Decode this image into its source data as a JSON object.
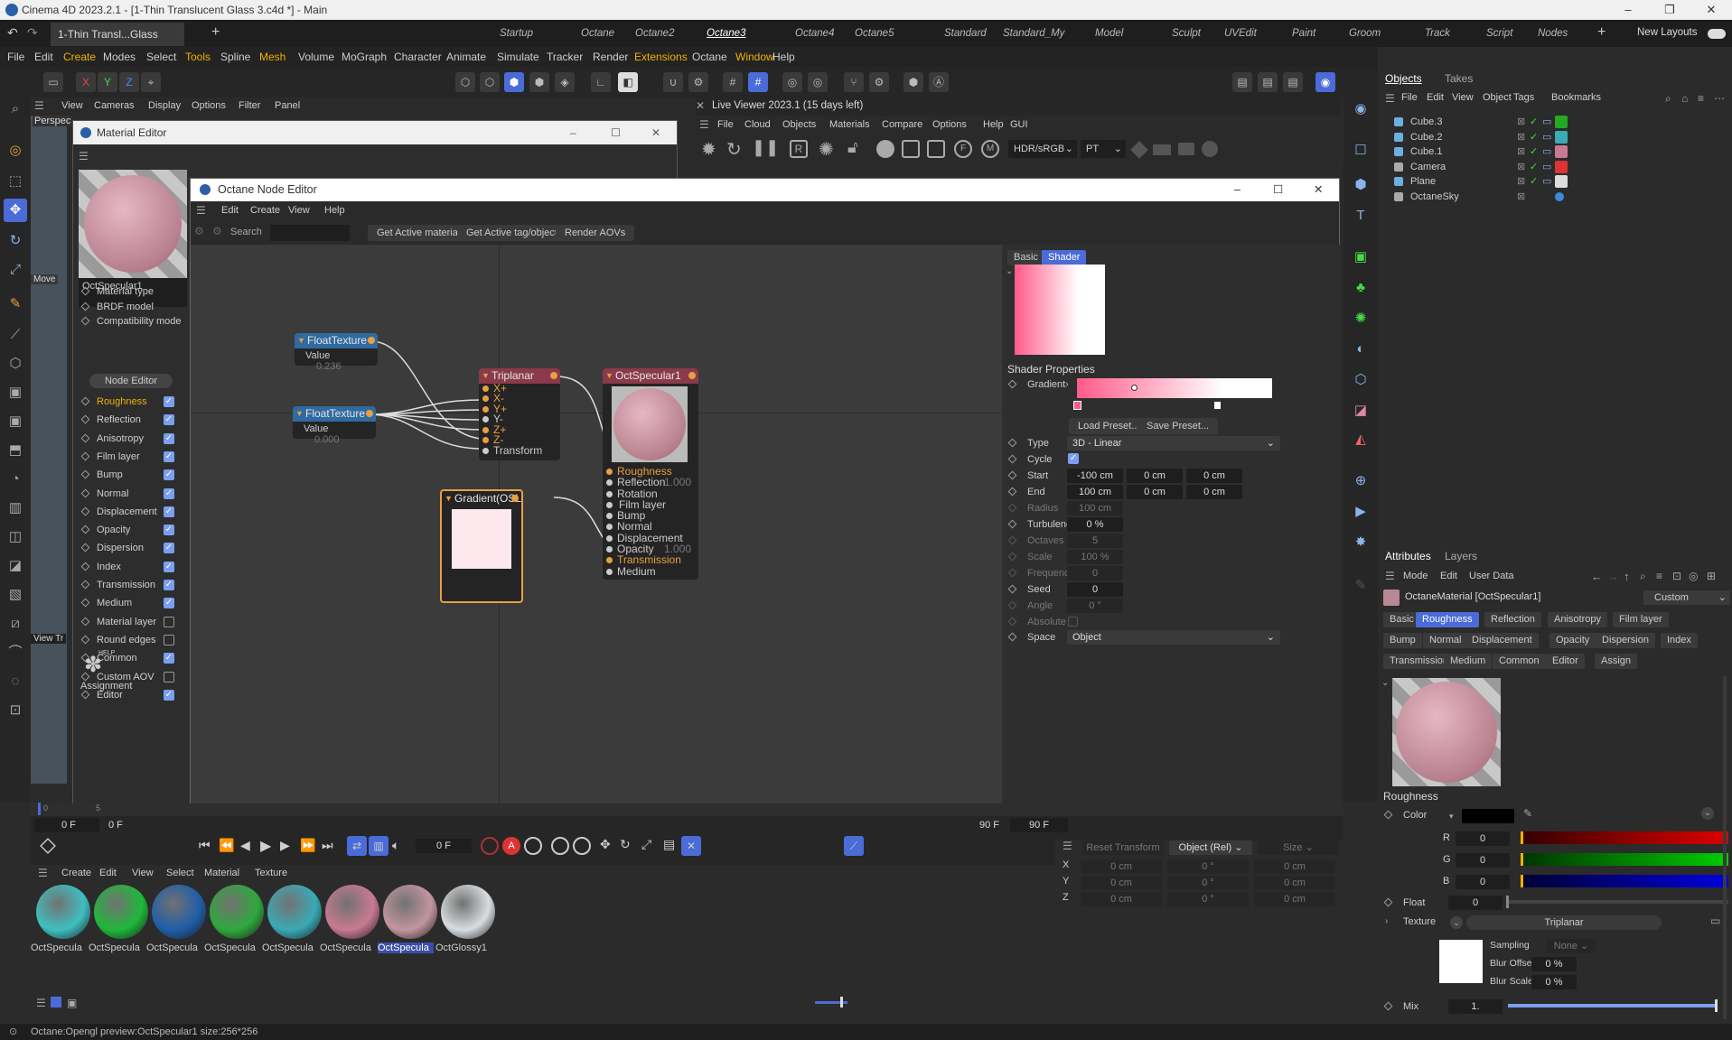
{
  "app": {
    "title": "Cinema 4D 2023.2.1 - [1-Thin Translucent Glass 3.c4d *] - Main",
    "doc_tab": "1-Thin Transl...Glass 3.c4d *"
  },
  "layouts": [
    "Startup",
    "Octane",
    "Octane2",
    "Octane3",
    "Octane4",
    "Octane5",
    "Standard",
    "Standard_My",
    "Model",
    "Sculpt",
    "UVEdit",
    "Paint",
    "Groom",
    "Track",
    "Script",
    "Nodes"
  ],
  "new_layouts": "New Layouts",
  "menu": [
    "File",
    "Edit",
    "Create",
    "Modes",
    "Select",
    "Tools",
    "Spline",
    "Mesh",
    "Volume",
    "MoGraph",
    "Character",
    "Animate",
    "Simulate",
    "Tracker",
    "Render",
    "Extensions",
    "Octane",
    "Window",
    "Help"
  ],
  "viewport": {
    "menu": [
      "View",
      "Cameras",
      "Display",
      "Options",
      "Filter",
      "Panel"
    ],
    "label": "Perspec",
    "move": "Move",
    "view_tr": "View Tr"
  },
  "live_viewer": {
    "title": "Live Viewer 2023.1 (15 days left)",
    "menu": [
      "File",
      "Cloud",
      "Objects",
      "Materials",
      "Compare",
      "Options",
      "Help",
      "GUI"
    ],
    "colorspace": "HDR/sRGB",
    "mode": "PT"
  },
  "material_editor": {
    "title": "Material Editor",
    "name": "OctSpecular1",
    "items": [
      {
        "label": "Material type",
        "cb": null
      },
      {
        "label": "BRDF model",
        "cb": null
      },
      {
        "label": "Compatibility mode",
        "cb": null
      }
    ],
    "node_editor_btn": "Node Editor",
    "channels": [
      {
        "label": "Roughness",
        "on": true,
        "active": true
      },
      {
        "label": "Reflection",
        "on": true
      },
      {
        "label": "Anisotropy",
        "on": true
      },
      {
        "label": "Film layer",
        "on": true
      },
      {
        "label": "Bump",
        "on": true
      },
      {
        "label": "Normal",
        "on": true
      },
      {
        "label": "Displacement",
        "on": true
      },
      {
        "label": "Opacity",
        "on": true
      },
      {
        "label": "Dispersion",
        "on": true
      },
      {
        "label": "Index",
        "on": true
      },
      {
        "label": "Transmission",
        "on": true
      },
      {
        "label": "Medium",
        "on": true
      },
      {
        "label": "Material layer",
        "on": false
      },
      {
        "label": "Round edges",
        "on": false
      },
      {
        "label": "Common",
        "on": true
      },
      {
        "label": "Custom AOV",
        "on": false
      },
      {
        "label": "Editor",
        "on": true
      }
    ],
    "help": "HELP",
    "assignment": "Assignment"
  },
  "node_editor": {
    "title": "Octane Node Editor",
    "menu": [
      "Edit",
      "Create",
      "View",
      "Help"
    ],
    "search_label": "Search",
    "buttons": [
      "Get Active material",
      "Get Active tag/object",
      "Render AOVs"
    ],
    "nodes": {
      "float1": {
        "title": "FloatTexture",
        "label": "Value",
        "value": "0.236"
      },
      "float2": {
        "title": "FloatTexture",
        "label": "Value",
        "value": "0.000"
      },
      "triplanar": {
        "title": "Triplanar",
        "ports": [
          "X+",
          "X-",
          "Y+",
          "Y-",
          "Z+",
          "Z-",
          "Transform"
        ]
      },
      "gradient": {
        "title": "Gradient(OSL"
      },
      "spec": {
        "title": "OctSpecular1",
        "ports": [
          {
            "label": "Roughness",
            "val": ""
          },
          {
            "label": "Reflection",
            "val": "1.000"
          },
          {
            "label": "Rotation",
            "val": ""
          },
          {
            "label": "Film layer",
            "val": ""
          },
          {
            "label": "Bump",
            "val": ""
          },
          {
            "label": "Normal",
            "val": ""
          },
          {
            "label": "Displacement",
            "val": ""
          },
          {
            "label": "Opacity",
            "val": "1.000"
          },
          {
            "label": "Transmission",
            "val": ""
          },
          {
            "label": "Medium",
            "val": ""
          }
        ]
      }
    },
    "panel": {
      "tabs": [
        "Basic",
        "Shader"
      ],
      "section": "Shader Properties",
      "gradient_label": "Gradient",
      "load_preset": "Load Preset...",
      "save_preset": "Save Preset...",
      "type_label": "Type",
      "type_value": "3D - Linear",
      "cycle_label": "Cycle",
      "start_label": "Start",
      "start": [
        "-100 cm",
        "0 cm",
        "0 cm"
      ],
      "end_label": "End",
      "end": [
        "100 cm",
        "0 cm",
        "0 cm"
      ],
      "radius_label": "Radius",
      "radius": "100 cm",
      "turbulence_label": "Turbulence",
      "turbulence": "0 %",
      "octaves_label": "Octaves",
      "octaves": "5",
      "scale_label": "Scale",
      "scale": "100 %",
      "frequency_label": "Frequency",
      "frequency": "0",
      "seed_label": "Seed",
      "seed": "0",
      "angle_label": "Angle",
      "angle": "0 °",
      "absolute_label": "Absolute",
      "space_label": "Space",
      "space": "Object"
    }
  },
  "objects": {
    "tabs": [
      "Objects",
      "Takes"
    ],
    "menu": [
      "File",
      "Edit",
      "View",
      "Object",
      "Tags",
      "Bookmarks"
    ],
    "items": [
      "Cube.3",
      "Cube.2",
      "Cube.1",
      "Camera",
      "Plane",
      "OctaneSky"
    ]
  },
  "attributes": {
    "tabs": [
      "Attributes",
      "Layers"
    ],
    "menu": [
      "Mode",
      "Edit",
      "User Data"
    ],
    "title": "OctaneMaterial [OctSpecular1]",
    "preset": "Custom",
    "tab_row1": [
      "Basic",
      "Roughness",
      "Reflection",
      "Anisotropy",
      "Film layer"
    ],
    "tab_row2": [
      "Bump",
      "Normal",
      "Displacement",
      "Opacity",
      "Dispersion",
      "Index"
    ],
    "tab_row3": [
      "Transmission",
      "Medium",
      "Common",
      "Editor",
      "Assign"
    ],
    "section": "Roughness",
    "color_label": "Color",
    "r_label": "R",
    "r": "0",
    "g_label": "G",
    "g": "0",
    "b_label": "B",
    "b": "0",
    "float_label": "Float",
    "float": "0",
    "texture_label": "Texture",
    "texture": "Triplanar",
    "sampling_label": "Sampling",
    "sampling": "None",
    "blur_offset_label": "Blur Offset",
    "blur_offset": "0 %",
    "blur_scale_label": "Blur Scale",
    "blur_scale": "0 %",
    "mix_label": "Mix",
    "mix": "1."
  },
  "timeline": {
    "start": "0 F",
    "start2": "0 F",
    "end": "90 F",
    "end2": "90 F",
    "frame": "0 F",
    "tick0": "0",
    "tick5": "5"
  },
  "coords": {
    "reset": "Reset Transform",
    "mode": "Object (Rel)",
    "size": "Size",
    "rows": [
      {
        "axis": "X",
        "p": "0 cm",
        "r": "0 °",
        "s": "0 cm"
      },
      {
        "axis": "Y",
        "p": "0 cm",
        "r": "0 °",
        "s": "0 cm"
      },
      {
        "axis": "Z",
        "p": "0 cm",
        "r": "0 °",
        "s": "0 cm"
      }
    ]
  },
  "mat_manager": {
    "menu": [
      "Create",
      "Edit",
      "View",
      "Select",
      "Material",
      "Texture"
    ],
    "materials": [
      {
        "name": "OctSpecula",
        "color": "#3fbfc0"
      },
      {
        "name": "OctSpecula",
        "color": "#1fb83a"
      },
      {
        "name": "OctSpecula",
        "color": "#1f5ea8"
      },
      {
        "name": "OctSpecula",
        "color": "#2fa83c"
      },
      {
        "name": "OctSpecula",
        "color": "#3aaab5"
      },
      {
        "name": "OctSpecula",
        "color": "#c87a92"
      },
      {
        "name": "OctSpecula",
        "color": "#c295a0",
        "selected": true
      },
      {
        "name": "OctGlossy1",
        "color": "#d8dde0"
      }
    ]
  },
  "status": "Octane:Opengl preview:OctSpecular1 size:256*256"
}
